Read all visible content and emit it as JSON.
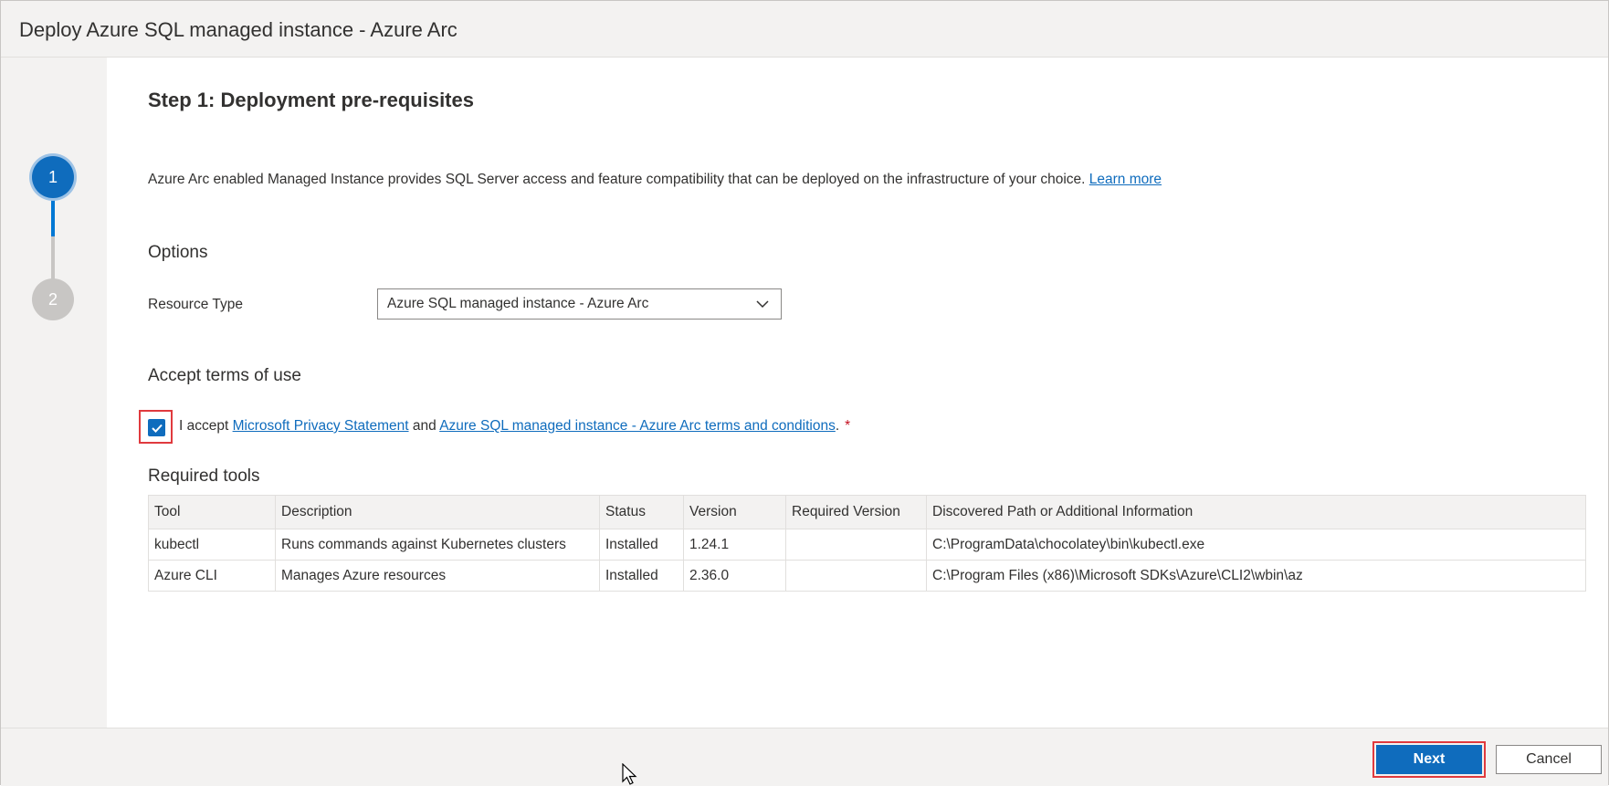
{
  "window": {
    "title": "Deploy Azure SQL managed instance - Azure Arc"
  },
  "stepper": {
    "steps": [
      {
        "number": "1",
        "state": "active"
      },
      {
        "number": "2",
        "state": "inactive"
      }
    ]
  },
  "step": {
    "title": "Step 1: Deployment pre-requisites",
    "description": "Azure Arc enabled Managed Instance provides SQL Server access and feature compatibility that can be deployed on the infrastructure of your choice.",
    "learn_more": "Learn more"
  },
  "options": {
    "heading": "Options",
    "resource_type_label": "Resource Type",
    "resource_type_value": "Azure SQL managed instance - Azure Arc"
  },
  "terms": {
    "heading": "Accept terms of use",
    "checked": true,
    "prefix": "I accept",
    "privacy_link": "Microsoft Privacy Statement",
    "and": "and",
    "terms_link": "Azure SQL managed instance - Azure Arc terms and conditions",
    "suffix": ".",
    "required_marker": "*"
  },
  "tools": {
    "heading": "Required tools",
    "columns": [
      "Tool",
      "Description",
      "Status",
      "Version",
      "Required Version",
      "Discovered Path or Additional Information"
    ],
    "rows": [
      [
        "kubectl",
        "Runs commands against Kubernetes clusters",
        "Installed",
        "1.24.1",
        "",
        "C:\\ProgramData\\chocolatey\\bin\\kubectl.exe"
      ],
      [
        "Azure CLI",
        "Manages Azure resources",
        "Installed",
        "2.36.0",
        "",
        "C:\\Program Files (x86)\\Microsoft SDKs\\Azure\\CLI2\\wbin\\az"
      ]
    ]
  },
  "footer": {
    "next_label": "Next",
    "cancel_label": "Cancel"
  },
  "colors": {
    "accent": "#0f6cbd",
    "highlight": "#e03a3e",
    "panel": "#f3f2f1"
  }
}
